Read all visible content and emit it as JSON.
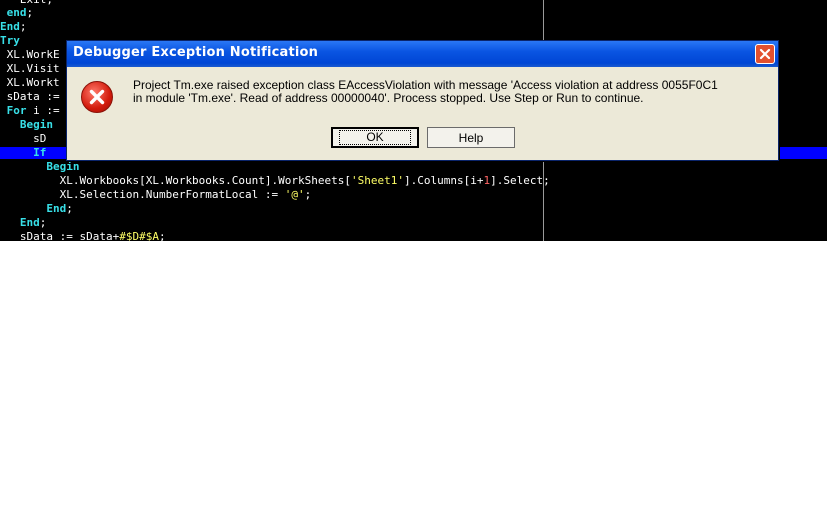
{
  "editor": {
    "lines": [
      {
        "indent": "   ",
        "parts": [
          {
            "t": "Exit;",
            "c": "sym"
          }
        ]
      },
      {
        "indent": " ",
        "parts": [
          {
            "t": "end",
            "c": "kw"
          },
          {
            "t": ";",
            "c": "sym"
          }
        ]
      },
      {
        "indent": "",
        "parts": [
          {
            "t": "End",
            "c": "kw"
          },
          {
            "t": ";",
            "c": "sym"
          }
        ]
      },
      {
        "indent": "",
        "parts": [
          {
            "t": "Try",
            "c": "kw"
          }
        ]
      },
      {
        "indent": " ",
        "parts": [
          {
            "t": "XL.WorkE",
            "c": "sym"
          }
        ]
      },
      {
        "indent": " ",
        "parts": [
          {
            "t": "XL.Visit",
            "c": "sym"
          }
        ]
      },
      {
        "indent": " ",
        "parts": [
          {
            "t": "XL.Workt",
            "c": "sym"
          }
        ]
      },
      {
        "indent": " ",
        "parts": [
          {
            "t": "sData :=",
            "c": "sym"
          }
        ]
      },
      {
        "indent": " ",
        "parts": [
          {
            "t": "For",
            "c": "kw"
          },
          {
            "t": " i :=",
            "c": "sym"
          }
        ]
      },
      {
        "indent": "   ",
        "parts": [
          {
            "t": "Begin",
            "c": "kw"
          }
        ]
      },
      {
        "indent": "     ",
        "parts": [
          {
            "t": "sD",
            "c": "sym"
          }
        ]
      },
      {
        "indent": "     ",
        "parts": [
          {
            "t": "If",
            "c": "kw"
          }
        ]
      },
      {
        "indent": "       ",
        "parts": [
          {
            "t": "Begin",
            "c": "kw"
          }
        ]
      },
      {
        "indent": "         ",
        "parts": [
          {
            "t": "XL.Workbooks[XL.Workbooks.Count].WorkSheets[",
            "c": "sym"
          },
          {
            "t": "'Sheet1'",
            "c": "str"
          },
          {
            "t": "].Columns[i+",
            "c": "sym"
          },
          {
            "t": "1",
            "c": "num"
          },
          {
            "t": "].Select;",
            "c": "sym"
          }
        ]
      },
      {
        "indent": "         ",
        "parts": [
          {
            "t": "XL.Selection.NumberFormatLocal := ",
            "c": "sym"
          },
          {
            "t": "'@'",
            "c": "str"
          },
          {
            "t": ";",
            "c": "sym"
          }
        ]
      },
      {
        "indent": "       ",
        "parts": [
          {
            "t": "End",
            "c": "kw"
          },
          {
            "t": ";",
            "c": "sym"
          }
        ]
      },
      {
        "indent": "   ",
        "parts": [
          {
            "t": "End",
            "c": "kw"
          },
          {
            "t": ";",
            "c": "sym"
          }
        ]
      },
      {
        "indent": "   ",
        "parts": [
          {
            "t": "sData := sData+",
            "c": "sym"
          },
          {
            "t": "#$D#$A",
            "c": "str"
          },
          {
            "t": ";",
            "c": "sym"
          }
        ]
      }
    ]
  },
  "dialog": {
    "title": "Debugger Exception Notification",
    "message_line1": "Project Tm.exe raised exception class EAccessViolation with message 'Access violation at address 0055F0C1",
    "message_line2": "in module 'Tm.exe'. Read of address 00000040'. Process stopped. Use Step or Run to continue.",
    "ok_label": "OK",
    "help_label": "Help",
    "close_symbol": "✕"
  }
}
